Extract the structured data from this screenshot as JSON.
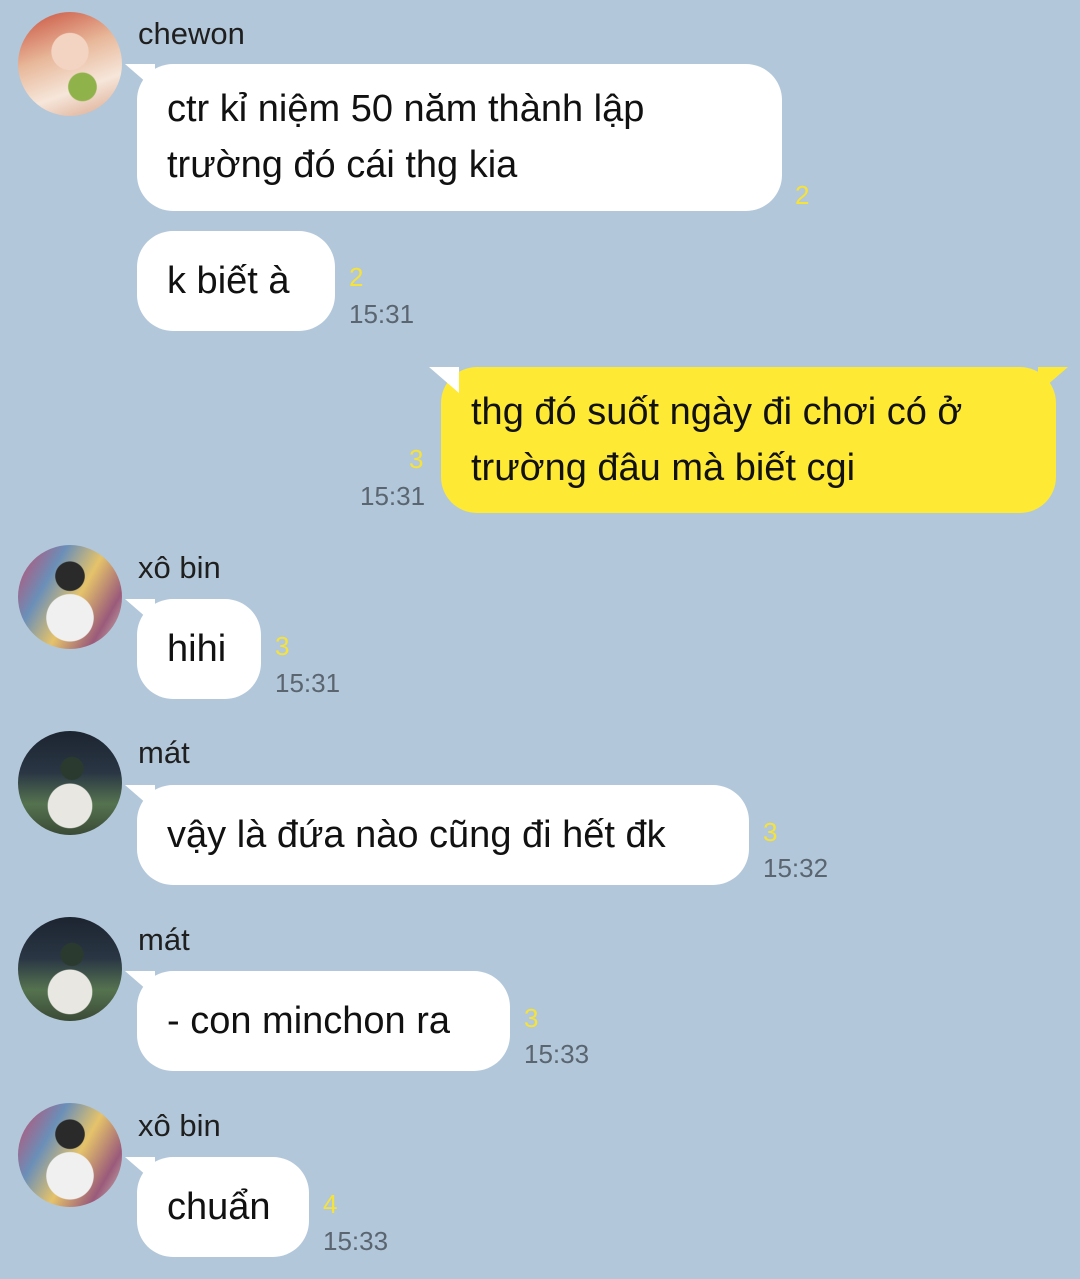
{
  "messages": [
    {
      "sender": "chewon",
      "text_lines": [
        "ctr kỉ niệm 50 năm thành lập",
        "trường đó cái thg kia"
      ],
      "unread": "2"
    },
    {
      "sender": "chewon",
      "text_lines": [
        "k biết à"
      ],
      "unread": "2",
      "time": "15:31"
    },
    {
      "sender": "me",
      "text_lines": [
        "thg đó suốt ngày đi chơi có ở",
        "trường đâu mà biết cgi"
      ],
      "unread": "3",
      "time": "15:31"
    },
    {
      "sender": "xô bin",
      "text_lines": [
        "hihi"
      ],
      "unread": "3",
      "time": "15:31"
    },
    {
      "sender": "mát",
      "text_lines": [
        "vậy là đứa nào cũng đi hết đk"
      ],
      "unread": "3",
      "time": "15:32"
    },
    {
      "sender": "mát",
      "text_lines": [
        "- con minchon ra"
      ],
      "unread": "3",
      "time": "15:33"
    },
    {
      "sender": "xô bin",
      "text_lines": [
        "chuẩn"
      ],
      "unread": "4",
      "time": "15:33"
    }
  ],
  "colors": {
    "background": "#b2c7da",
    "my_bubble": "#fee934",
    "other_bubble": "#ffffff",
    "unread": "#f5e23a"
  }
}
